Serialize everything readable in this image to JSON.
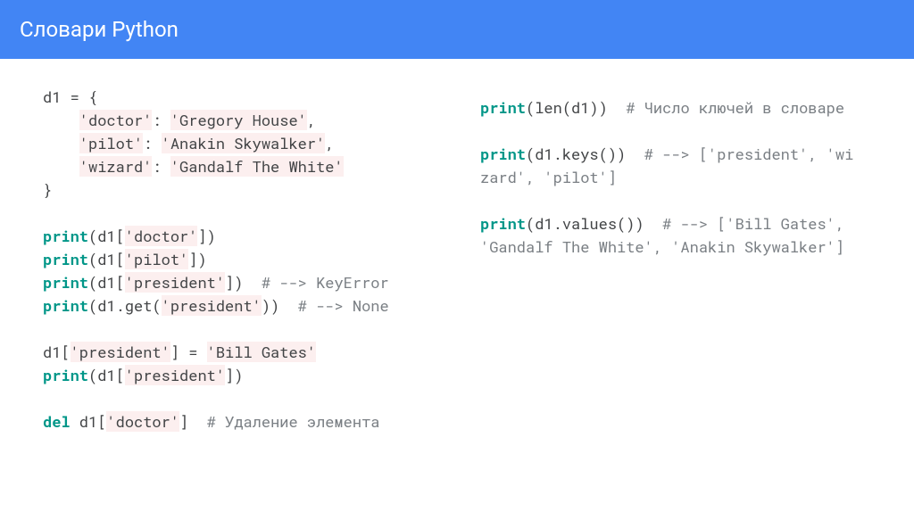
{
  "header": {
    "title": "Словари Python"
  },
  "code_left": [
    {
      "tokens": [
        {
          "t": "d1 = {",
          "c": "plain"
        }
      ]
    },
    {
      "tokens": [
        {
          "t": "    ",
          "c": "plain"
        },
        {
          "t": "'doctor'",
          "c": "str"
        },
        {
          "t": ": ",
          "c": "plain"
        },
        {
          "t": "'Gregory House'",
          "c": "str"
        },
        {
          "t": ",",
          "c": "plain"
        }
      ]
    },
    {
      "tokens": [
        {
          "t": "    ",
          "c": "plain"
        },
        {
          "t": "'pilot'",
          "c": "str"
        },
        {
          "t": ": ",
          "c": "plain"
        },
        {
          "t": "'Anakin Skywalker'",
          "c": "str"
        },
        {
          "t": ",",
          "c": "plain"
        }
      ]
    },
    {
      "tokens": [
        {
          "t": "    ",
          "c": "plain"
        },
        {
          "t": "'wizard'",
          "c": "str"
        },
        {
          "t": ": ",
          "c": "plain"
        },
        {
          "t": "'Gandalf The White'",
          "c": "str"
        }
      ]
    },
    {
      "tokens": [
        {
          "t": "}",
          "c": "plain"
        }
      ]
    },
    {
      "tokens": []
    },
    {
      "tokens": [
        {
          "t": "print",
          "c": "kw"
        },
        {
          "t": "(d1[",
          "c": "call"
        },
        {
          "t": "'doctor'",
          "c": "str"
        },
        {
          "t": "])",
          "c": "call"
        }
      ]
    },
    {
      "tokens": [
        {
          "t": "print",
          "c": "kw"
        },
        {
          "t": "(d1[",
          "c": "call"
        },
        {
          "t": "'pilot'",
          "c": "str"
        },
        {
          "t": "])",
          "c": "call"
        }
      ]
    },
    {
      "tokens": [
        {
          "t": "print",
          "c": "kw"
        },
        {
          "t": "(d1[",
          "c": "call"
        },
        {
          "t": "'president'",
          "c": "str"
        },
        {
          "t": "])",
          "c": "call"
        },
        {
          "t": "  ",
          "c": "plain"
        },
        {
          "t": "# --> KeyError",
          "c": "comment"
        }
      ]
    },
    {
      "tokens": [
        {
          "t": "print",
          "c": "kw"
        },
        {
          "t": "(d1.get(",
          "c": "call"
        },
        {
          "t": "'president'",
          "c": "str"
        },
        {
          "t": "))",
          "c": "call"
        },
        {
          "t": "  ",
          "c": "plain"
        },
        {
          "t": "# --> None",
          "c": "comment"
        }
      ]
    },
    {
      "tokens": []
    },
    {
      "tokens": [
        {
          "t": "d1[",
          "c": "plain"
        },
        {
          "t": "'president'",
          "c": "str"
        },
        {
          "t": "] = ",
          "c": "plain"
        },
        {
          "t": "'Bill Gates'",
          "c": "str"
        }
      ]
    },
    {
      "tokens": [
        {
          "t": "print",
          "c": "kw"
        },
        {
          "t": "(d1[",
          "c": "call"
        },
        {
          "t": "'president'",
          "c": "str"
        },
        {
          "t": "])",
          "c": "call"
        }
      ]
    },
    {
      "tokens": []
    },
    {
      "tokens": [
        {
          "t": "del",
          "c": "kw"
        },
        {
          "t": " d1[",
          "c": "plain"
        },
        {
          "t": "'doctor'",
          "c": "str"
        },
        {
          "t": "]",
          "c": "plain"
        },
        {
          "t": "  ",
          "c": "plain"
        },
        {
          "t": "# Удаление элемента",
          "c": "comment"
        }
      ]
    }
  ],
  "code_right": [
    {
      "tokens": [
        {
          "t": "print",
          "c": "kw"
        },
        {
          "t": "(len(d1))",
          "c": "call"
        },
        {
          "t": "  ",
          "c": "plain"
        },
        {
          "t": "# Число ключей в словаре",
          "c": "comment"
        }
      ]
    },
    {
      "tokens": []
    },
    {
      "tokens": [
        {
          "t": "print",
          "c": "kw"
        },
        {
          "t": "(d1.keys())",
          "c": "call"
        },
        {
          "t": "  ",
          "c": "plain"
        },
        {
          "t": "# --> ['president', 'wizard', 'pilot']",
          "c": "comment"
        }
      ]
    },
    {
      "tokens": []
    },
    {
      "tokens": [
        {
          "t": "print",
          "c": "kw"
        },
        {
          "t": "(d1.values())",
          "c": "call"
        },
        {
          "t": "  ",
          "c": "plain"
        },
        {
          "t": "# --> ['Bill Gates', 'Gandalf The White', 'Anakin Skywalker']",
          "c": "comment"
        }
      ]
    }
  ]
}
